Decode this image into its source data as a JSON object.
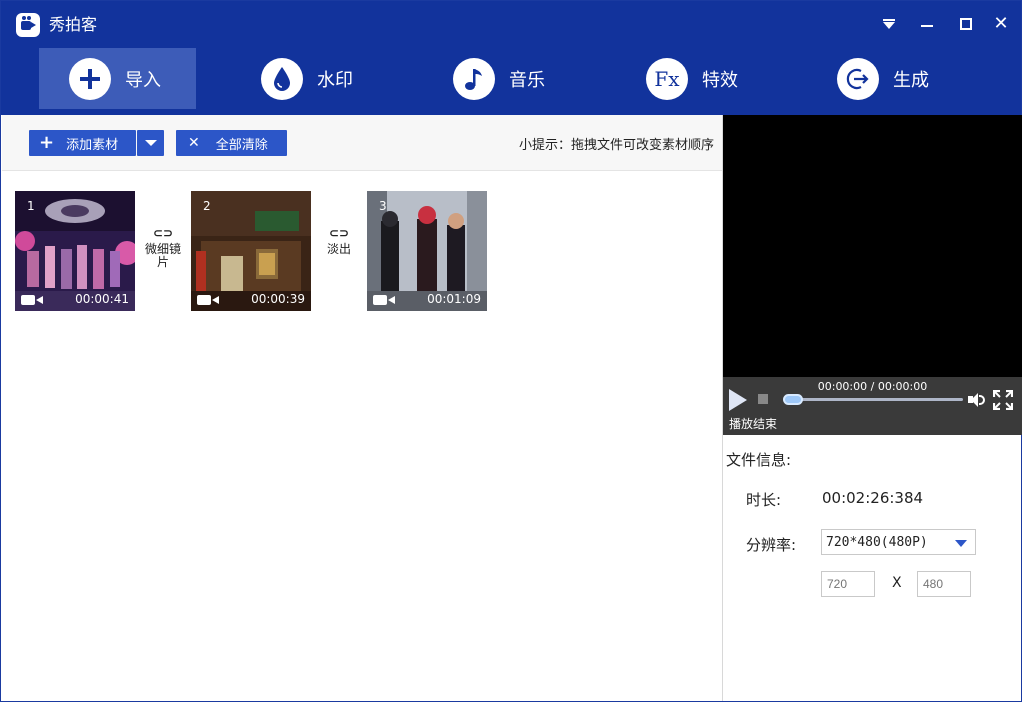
{
  "window": {
    "title": "秀拍客",
    "controls": {
      "menu": "menu-dropdown-icon",
      "minimize": "minimize-icon",
      "maximize": "maximize-icon",
      "close": "close-icon"
    }
  },
  "tabs": [
    {
      "label": "导入",
      "icon": "plus-icon",
      "active": true
    },
    {
      "label": "水印",
      "icon": "water-drop-icon",
      "active": false
    },
    {
      "label": "音乐",
      "icon": "music-note-icon",
      "active": false
    },
    {
      "label": "特效",
      "icon": "fx-icon",
      "icon_text": "Fx",
      "active": false
    },
    {
      "label": "生成",
      "icon": "export-icon",
      "active": false
    }
  ],
  "toolbar": {
    "add_label": "添加素材",
    "clear_label": "全部清除",
    "hint": "小提示：拖拽文件可改变素材顺序"
  },
  "clips": [
    {
      "index": "1",
      "duration": "00:00:41"
    },
    {
      "index": "2",
      "duration": "00:00:39"
    },
    {
      "index": "3",
      "duration": "00:01:09"
    }
  ],
  "transitions": [
    {
      "label": "微细镜片"
    },
    {
      "label": "淡出"
    }
  ],
  "player": {
    "time": "00:00:00 / 00:00:00",
    "status": "播放结束",
    "progress": 0
  },
  "file_info": {
    "title": "文件信息:",
    "duration_label": "时长:",
    "duration_value": "00:02:26:384",
    "resolution_label": "分辨率:",
    "resolution_value": "720*480(480P)",
    "width_placeholder": "720",
    "height_placeholder": "480",
    "separator": "X"
  },
  "colors": {
    "header_bg": "#12339c",
    "active_tab": "#3d5cb8",
    "button": "#2c56c8"
  }
}
